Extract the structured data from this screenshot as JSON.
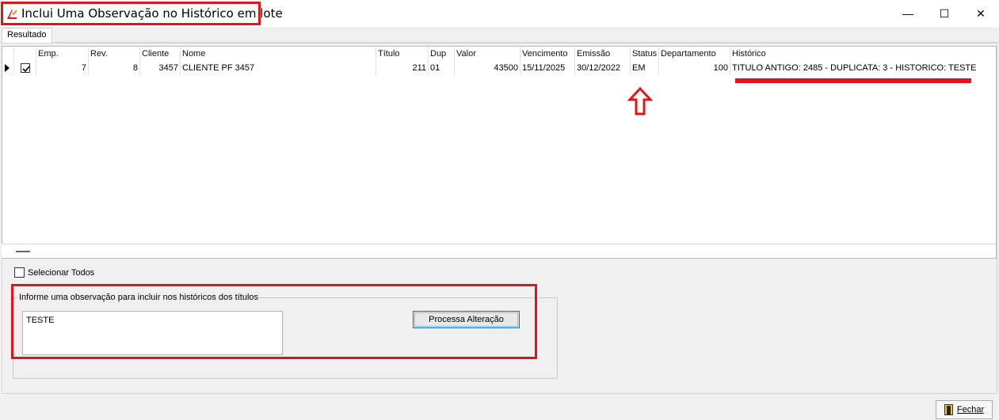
{
  "window": {
    "title": "Inclui Uma Observação no Histórico em lote",
    "minimize_glyph": "—",
    "maximize_glyph": "☐",
    "close_glyph": "✕"
  },
  "tabs": [
    {
      "label": "Resultado"
    }
  ],
  "grid": {
    "columns": [
      "Emp.",
      "Rev.",
      "Cliente",
      "Nome",
      "Título",
      "Dup",
      "Valor",
      "Vencimento",
      "Emissão",
      "Status",
      "Departamento",
      "Histórico"
    ],
    "rows": [
      {
        "checked": true,
        "emp": "7",
        "rev": "8",
        "cliente": "3457",
        "nome": "CLIENTE PF 3457",
        "titulo": "211",
        "dup": "01",
        "valor": "43500",
        "vencimento": "15/11/2025",
        "emissao": "30/12/2022",
        "status": "EM",
        "departamento": "100",
        "historico": "TITULO ANTIGO: 2485 - DUPLICATA: 3 - HISTORICO: TESTE"
      }
    ]
  },
  "select_all": {
    "label": "Selecionar Todos",
    "checked": false
  },
  "observation": {
    "group_label": "Informe uma observação para incluir nos históricos dos títulos",
    "value": "TESTE",
    "process_button": "Processa Alteração"
  },
  "footer": {
    "close_button": "Fechar"
  },
  "colors": {
    "annotation_red": "#e3131b",
    "focus_blue": "#1c64c8"
  }
}
